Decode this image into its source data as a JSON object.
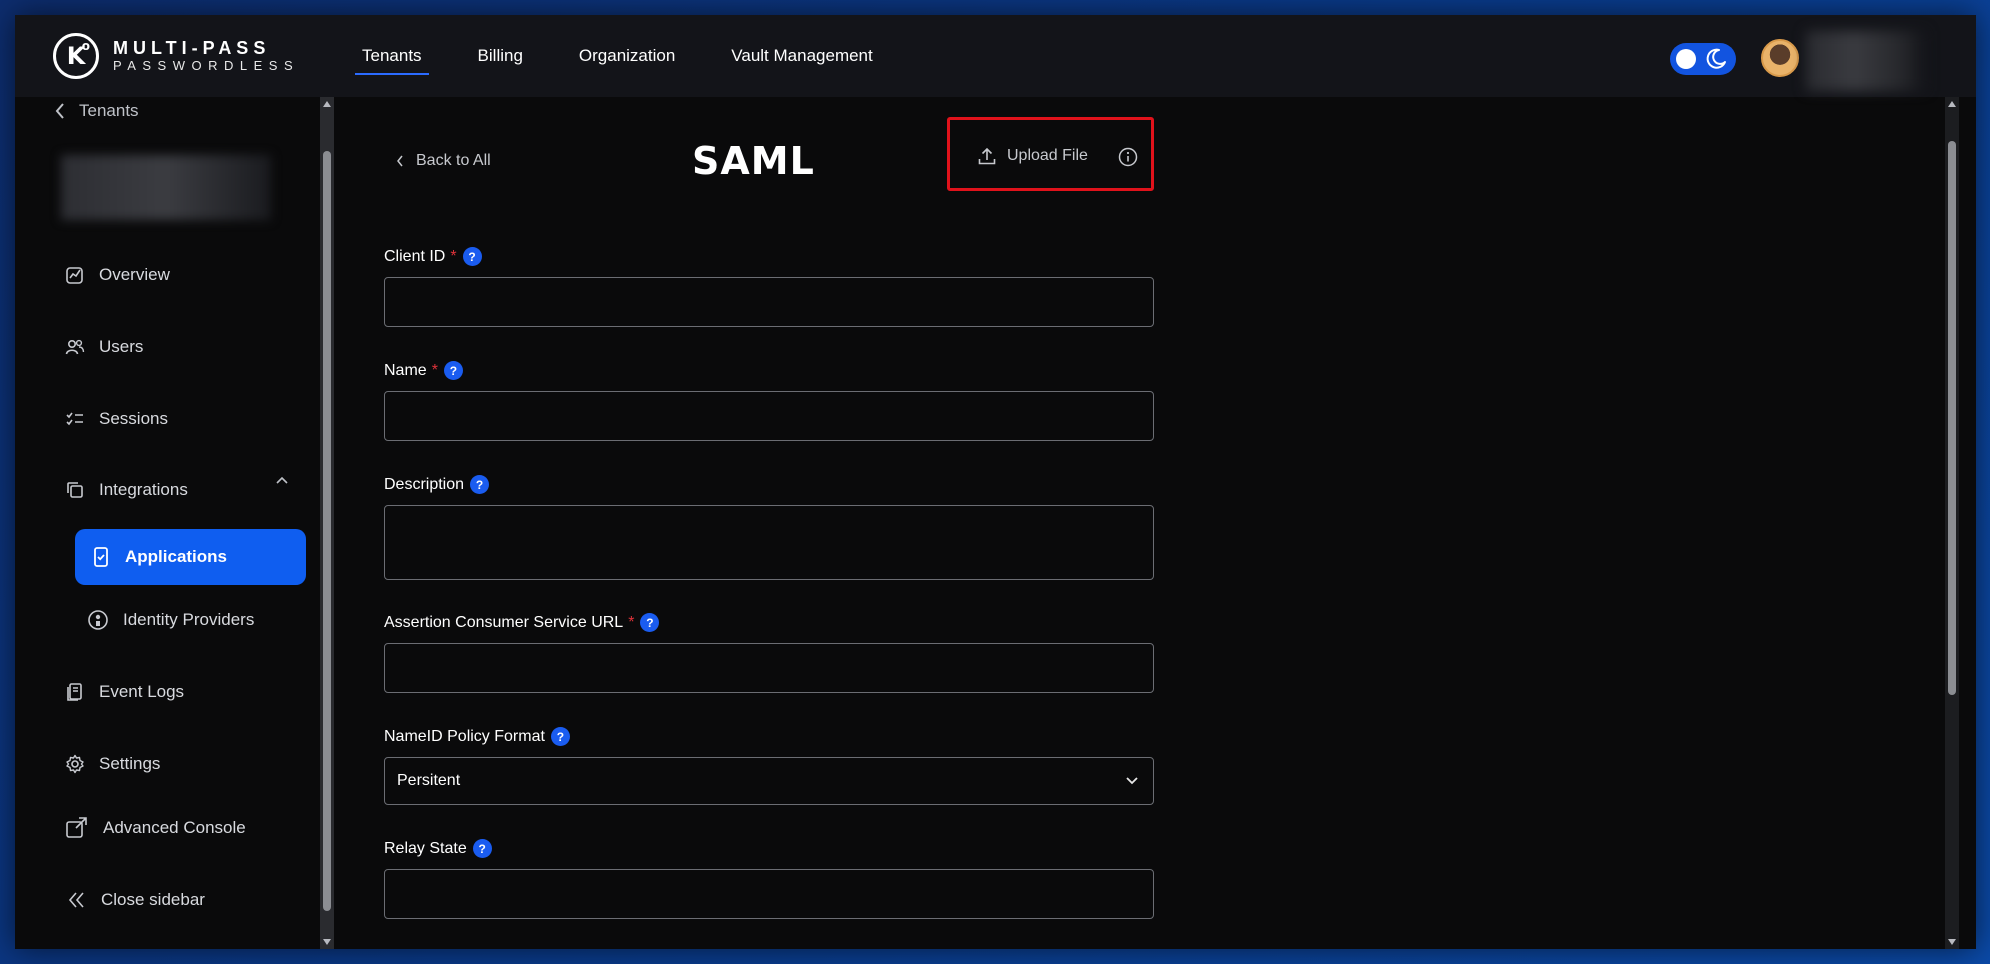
{
  "header": {
    "logo_line1": "MULTI-PASS",
    "logo_line2": "PASSWORDLESS",
    "logo_mark": "K",
    "logo_sup": "o",
    "nav": [
      {
        "label": "Tenants",
        "active": true
      },
      {
        "label": "Billing"
      },
      {
        "label": "Organization"
      },
      {
        "label": "Vault Management"
      }
    ]
  },
  "sidebar": {
    "back_label": "Tenants",
    "items": {
      "overview": "Overview",
      "users": "Users",
      "sessions": "Sessions",
      "integrations": "Integrations",
      "applications": "Applications",
      "identity_providers": "Identity Providers",
      "event_logs": "Event Logs",
      "settings": "Settings",
      "advanced_console": "Advanced Console",
      "close_sidebar": "Close sidebar"
    }
  },
  "main": {
    "back_label": "Back to All",
    "title": "SAML",
    "upload_label": "Upload File",
    "fields": {
      "client_id": {
        "label": "Client ID",
        "required": "*",
        "help": "?",
        "value": ""
      },
      "name": {
        "label": "Name",
        "required": "*",
        "help": "?",
        "value": ""
      },
      "description": {
        "label": "Description",
        "help": "?",
        "value": ""
      },
      "acs_url": {
        "label": "Assertion Consumer Service URL",
        "required": "*",
        "help": "?",
        "value": ""
      },
      "nameid_policy": {
        "label": "NameID Policy Format",
        "help": "?",
        "value": "Persitent"
      },
      "relay_state": {
        "label": "Relay State",
        "help": "?",
        "value": ""
      }
    }
  },
  "colors": {
    "accent": "#0f5ef0",
    "highlight_border": "#e0121b",
    "background": "#0a0a0b",
    "topbar": "#131419"
  }
}
